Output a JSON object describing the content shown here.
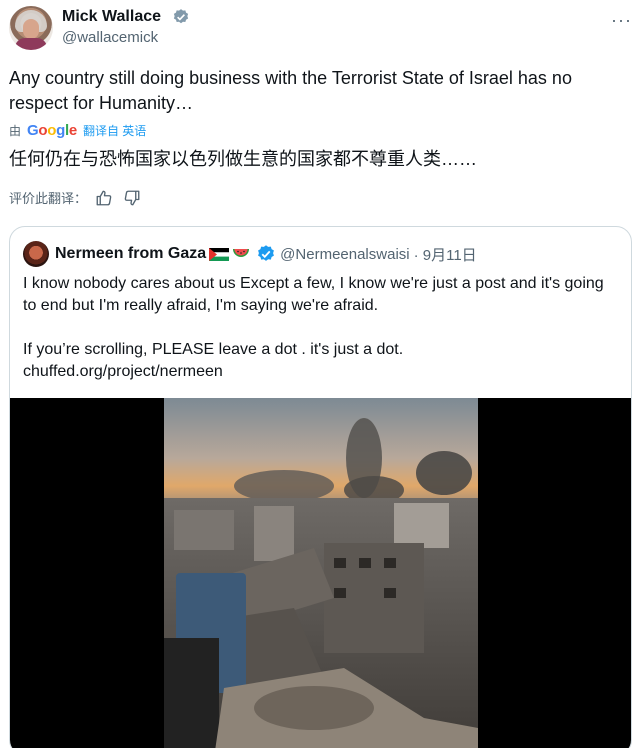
{
  "author": {
    "name": "Mick Wallace",
    "handle": "@wallacemick"
  },
  "tweet": {
    "text": "Any country still doing business with the Terrorist State of Israel has no respect for Humanity…"
  },
  "translation": {
    "by_label": "由",
    "engine": "Google",
    "from_label": "翻译自 英语",
    "text": "任何仍在与恐怖国家以色列做生意的国家都不尊重人类……",
    "rate_label": "评价此翻译："
  },
  "quoted": {
    "name": "Nermeen from Gaza",
    "handle": "@Nermeenalswaisi",
    "date": "· 9月11日",
    "para1": "I know nobody cares about us Except a few, I know we're just a post and it's going to end but I'm really afraid, I'm saying we're afraid.",
    "para2": "If you’re scrolling, PLEASE leave a dot . it's just a dot.",
    "link": "chuffed.org/project/nermeen"
  },
  "icons": {
    "verified": "verified-badge-icon",
    "more": "more-options-icon",
    "thumbs_up": "thumbs-up-icon",
    "thumbs_down": "thumbs-down-icon",
    "flag": "palestine-flag-icon",
    "watermelon": "watermelon-icon"
  },
  "colors": {
    "accent": "#1d9bf0",
    "secondary_text": "#536471",
    "border": "#cfd9de"
  }
}
